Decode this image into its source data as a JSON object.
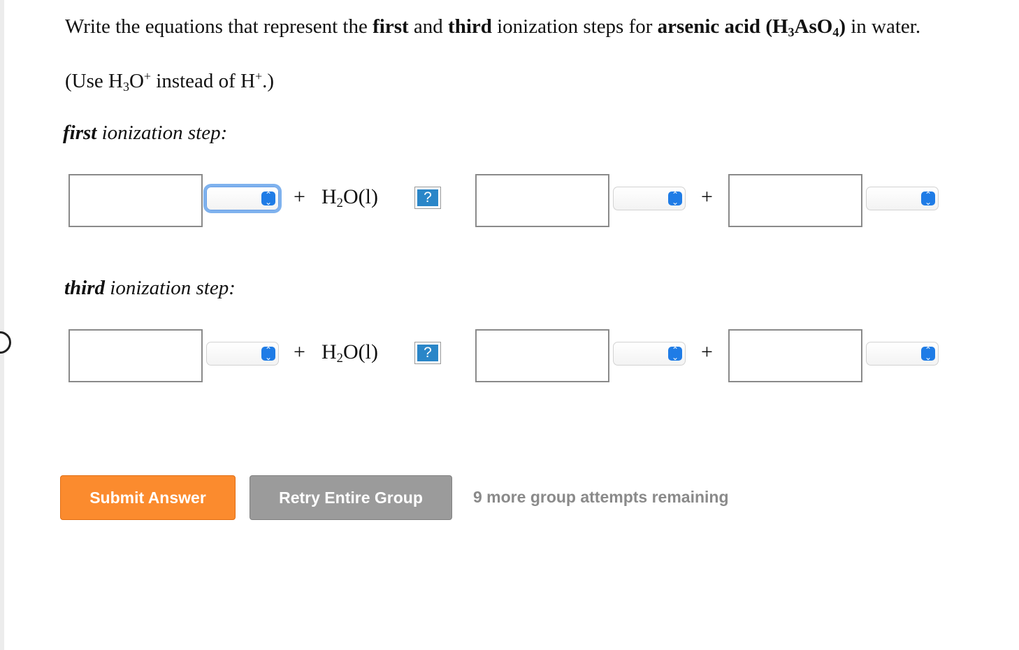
{
  "question": {
    "part1": "Write the equations that represent the ",
    "first": "first",
    "and": " and ",
    "third": "third",
    "part2": " ionization steps for ",
    "acid_name": "arsenic acid",
    "formula_open": " (H",
    "formula_sub3": "3",
    "formula_as": "AsO",
    "formula_sub4": "4",
    "formula_close": ")",
    "part3": " in water."
  },
  "note": {
    "open": "(Use H",
    "sub3": "3",
    "o": "O",
    "plus1": "+",
    "mid": " instead of H",
    "plus2": "+",
    "close": ".)"
  },
  "steps": [
    {
      "label_bold": "first",
      "label_rest": " ionization step:"
    },
    {
      "label_bold": "third",
      "label_rest": " ionization step:"
    }
  ],
  "equation": {
    "plus": "+",
    "water_h": "H",
    "water_sub": "2",
    "water_rest": "O(l)",
    "help": "?"
  },
  "buttons": {
    "submit": "Submit Answer",
    "retry": "Retry Entire Group"
  },
  "attempts": "9 more group attempts remaining",
  "colors": {
    "submit_bg": "#fb8b2e",
    "retry_bg": "#9b9b9b",
    "select_focus": "#7fb2ee",
    "caret": "#1f7ce6",
    "help_bg": "#2a86c8"
  }
}
